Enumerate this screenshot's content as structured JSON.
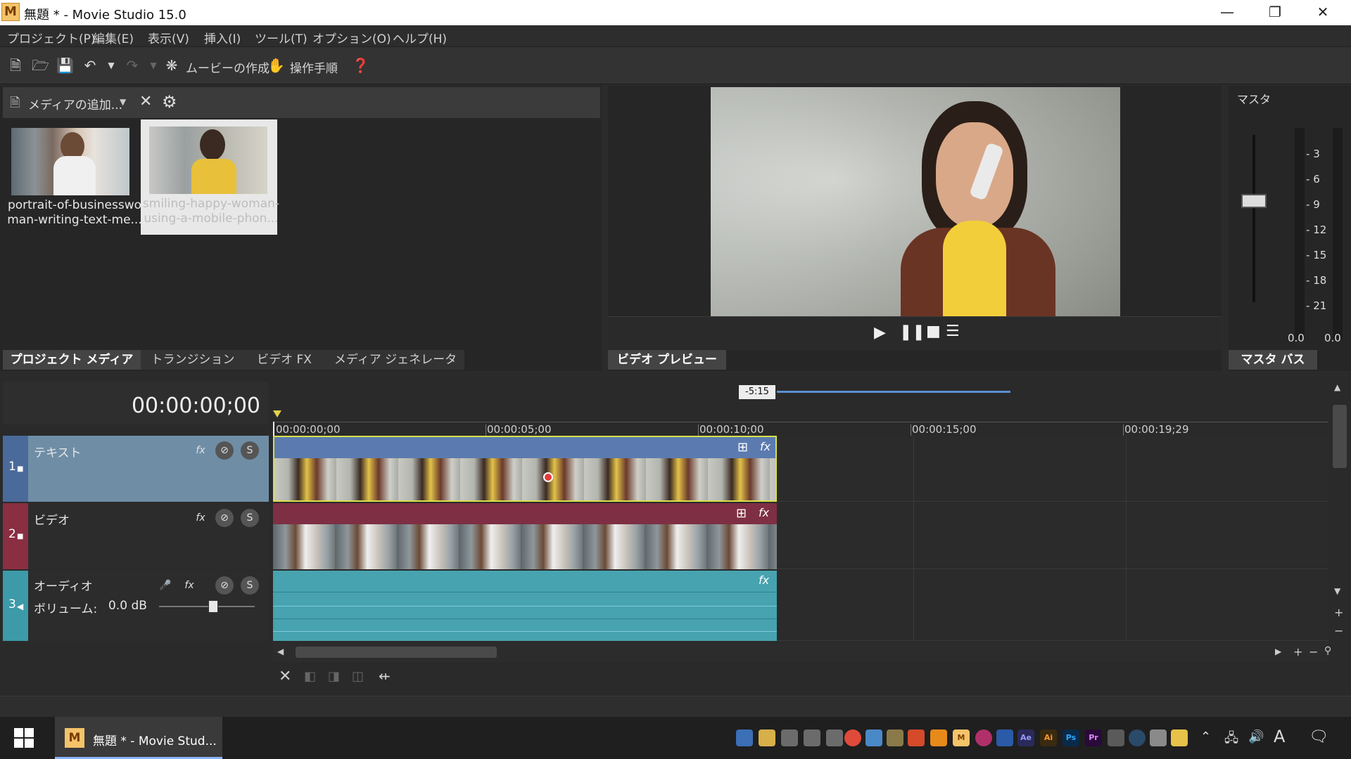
{
  "window": {
    "title": "無題 * - Movie Studio 15.0",
    "logo": "M"
  },
  "menu": [
    "プロジェクト(P)",
    "編集(E)",
    "表示(V)",
    "挿入(I)",
    "ツール(T)",
    "オプション(O)",
    "ヘルプ(H)"
  ],
  "toolbar": {
    "make_movie": "ムービーの作成",
    "guide": "操作手順"
  },
  "media": {
    "add_label": "メディアの追加...",
    "items": [
      {
        "caption": "portrait-of-businesswo man-writing-text-me...",
        "selected": false
      },
      {
        "caption": "smiling-happy-woman- using-a-mobile-phon...",
        "selected": true
      }
    ],
    "tabs": [
      "プロジェクト メディア",
      "トランジション",
      "ビデオ FX",
      "メディア ジェネレータ"
    ]
  },
  "preview": {
    "tab": "ビデオ プレビュー"
  },
  "master": {
    "title": "マスタ",
    "ticks": [
      "3",
      "6",
      "9",
      "12",
      "15",
      "18",
      "21"
    ],
    "left_value": "0.0",
    "right_value": "0.0",
    "tab": "マスタ バス"
  },
  "timeline": {
    "timecode": "00:00:00;00",
    "selection_length": "-5:15",
    "ruler": [
      "00:00:00;00",
      "00:00:05;00",
      "00:00:10;00",
      "00:00:15;00",
      "00:00:19;29"
    ],
    "tracks": [
      {
        "num": "1",
        "name": "テキスト",
        "color": "#4a6a9a"
      },
      {
        "num": "2",
        "name": "ビデオ",
        "color": "#8a2e42"
      },
      {
        "num": "3",
        "name": "オーディオ",
        "color": "#3d9aa8",
        "volume_label": "ボリューム:",
        "volume_value": "0.0 dB"
      }
    ]
  },
  "taskbar": {
    "app_label": "無題 * - Movie Stud..."
  },
  "colors": {
    "accent_clip_border": "#d9e04a",
    "text_track": "#5b7bb0",
    "video_track": "#7e2f44",
    "audio_track": "#47a3b0"
  }
}
